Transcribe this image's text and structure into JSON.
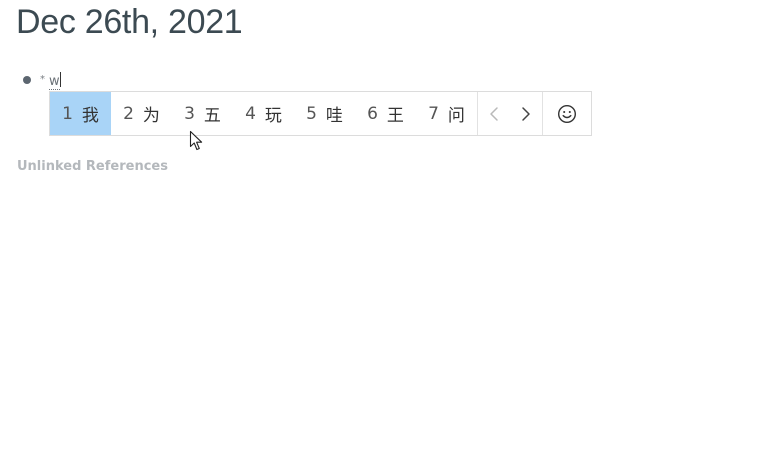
{
  "page": {
    "title": "Dec 26th, 2021"
  },
  "block": {
    "marker": "*",
    "composing_text": "w"
  },
  "ime": {
    "candidates": [
      {
        "num": "1",
        "char": "我"
      },
      {
        "num": "2",
        "char": "为"
      },
      {
        "num": "3",
        "char": "五"
      },
      {
        "num": "4",
        "char": "玩"
      },
      {
        "num": "5",
        "char": "哇"
      },
      {
        "num": "6",
        "char": "王"
      },
      {
        "num": "7",
        "char": "问"
      }
    ],
    "selected_index": 0,
    "prev_icon": "chevron-left-icon",
    "next_icon": "chevron-right-icon",
    "emoji_icon": "smiley-icon",
    "selected_color": "#a9d4f7"
  },
  "references": {
    "unlinked_label": "Unlinked References"
  }
}
